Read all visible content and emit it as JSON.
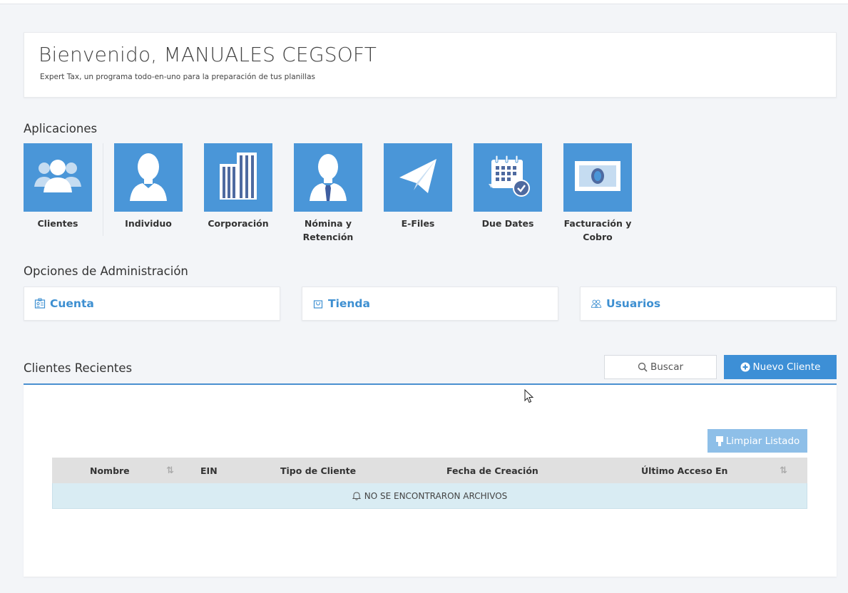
{
  "welcome": {
    "title": "Bienvenido, MANUALES CEGSOFT",
    "subtitle": "Expert Tax, un programa todo-en-uno para la preparación de tus planillas"
  },
  "apps": {
    "title": "Aplicaciones",
    "items": [
      {
        "label": "Clientes",
        "icon": "users-icon"
      },
      {
        "label": "Individuo",
        "icon": "person-icon"
      },
      {
        "label": "Corporación",
        "icon": "buildings-icon"
      },
      {
        "label": "Nómina y Retención",
        "icon": "person-tie-icon"
      },
      {
        "label": "E-Files",
        "icon": "paper-plane-icon"
      },
      {
        "label": "Due Dates",
        "icon": "calendar-check-icon"
      },
      {
        "label": "Facturación y Cobro",
        "icon": "money-bill-icon"
      }
    ]
  },
  "admin": {
    "title": "Opciones de Administración",
    "items": [
      {
        "label": "Cuenta",
        "icon": "account-card-icon"
      },
      {
        "label": "Tienda",
        "icon": "shopping-bag-icon"
      },
      {
        "label": "Usuarios",
        "icon": "users-outline-icon"
      }
    ]
  },
  "recent": {
    "title": "Clientes Recientes",
    "search_label": "Buscar",
    "new_client_label": "Nuevo Cliente",
    "clear_label": "Limpiar Listado",
    "columns": [
      "Nombre",
      "EIN",
      "Tipo de Cliente",
      "Fecha de Creación",
      "Último Acceso En"
    ],
    "empty_message": "NO SE ENCONTRARON ARCHIVOS"
  },
  "colors": {
    "tile_blue": "#4a96d8",
    "link_blue": "#3d8fd1",
    "primary_button": "#3d8fd6",
    "empty_row": "#d9ecf3"
  }
}
